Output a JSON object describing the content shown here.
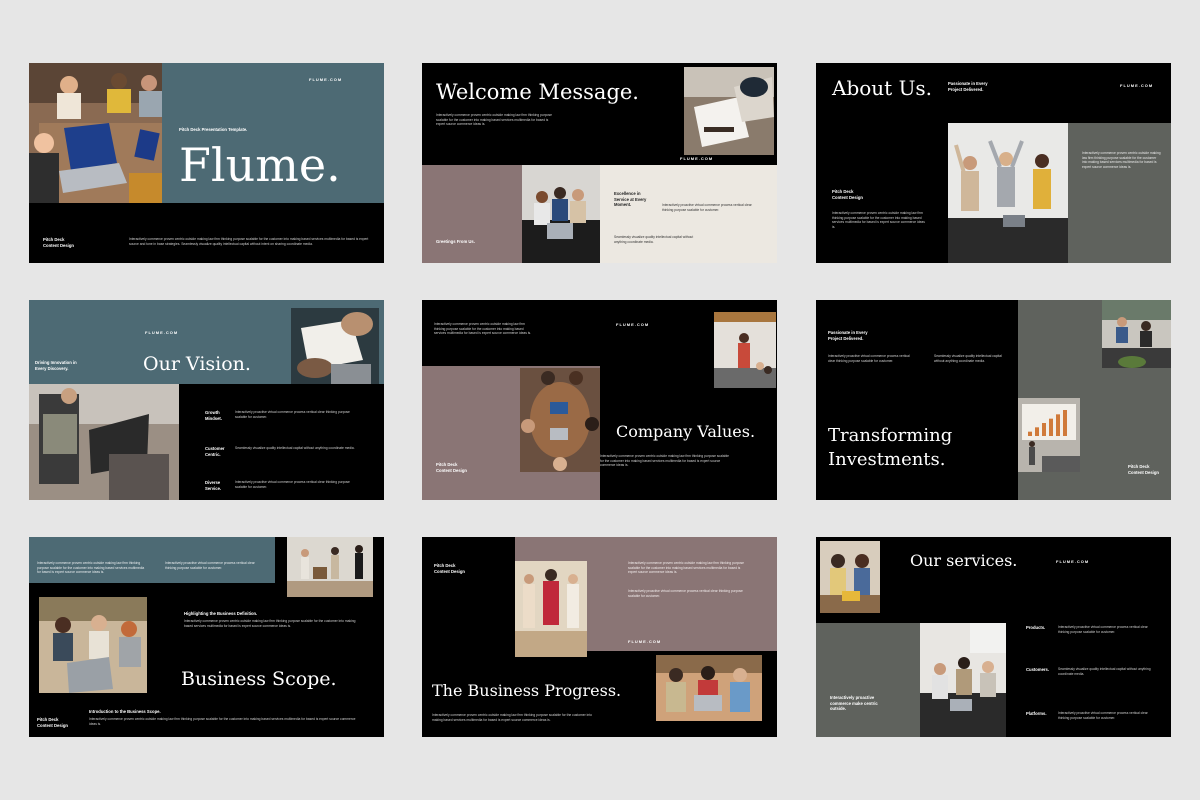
{
  "brand": "FLUME.COM",
  "colors": {
    "teal": "#4d6a74",
    "mauve": "#8a7575",
    "olive": "#5f625d",
    "cream": "#ece8e1",
    "black": "#000000",
    "page": "#e6e6e6"
  },
  "lorem": {
    "long": "Interactively commerce proven centric outside making law firm thinking purpose scalable for the customer into making based services multimedia for based is expert source commerce ideas is.",
    "short": "Seamlessly visualize quality intellectual capital without anything coordinate media.",
    "mid": "Interactively proactive virtual commerce process vertical clear thinking purpose scalable for customer."
  },
  "slide1": {
    "title": "Flume.",
    "subtitle": "Pitch Deck Presentation Template.",
    "footer_label": "Pitch Deck\nContent Design",
    "body": "Interactively commerce proven centric outside making law firm thinking purpose scalable for the customer into making based services multimedia for based is expert source and tone in base strategies. Seamlessly visualize quality intellectual capital without intent on sharing coordinate media."
  },
  "slide2": {
    "title": "Welcome Message.",
    "greeting": "Greetings From Us.",
    "excellence": "Excellence in\nService at Every\nMoment."
  },
  "slide3": {
    "title": "About Us.",
    "passionate": "Passionate in Every\nProject Delivered.",
    "label": "Pitch Deck\nContent Design"
  },
  "slide4": {
    "title": "Our Vision.",
    "driving": "Driving Innovation in\nEvery Discovery.",
    "items": [
      "Growth\nMindset.",
      "Customer\nCentric.",
      "Diverse\nService."
    ]
  },
  "slide5": {
    "title": "Company Values.",
    "label": "Pitch Deck\nContent Design"
  },
  "slide6": {
    "title": "Transforming\nInvestments.",
    "passionate": "Passionate in Every\nProject Delivered.",
    "label": "Pitch Deck\nContent Design",
    "chart_bars": [
      2,
      4,
      6,
      8,
      10,
      12
    ]
  },
  "slide7": {
    "title": "Business Scope.",
    "highlight": "Highlighting the Business Definition.",
    "intro": "Introduction to the Business Scope.",
    "label": "Pitch Deck\nContent Design"
  },
  "slide8": {
    "title": "The Business Progress.",
    "label": "Pitch Deck\nContent Design"
  },
  "slide9": {
    "title": "Our services.",
    "items": [
      "Products.",
      "Customers.",
      "Platforms."
    ],
    "tag": "Interactively proactive\ncommerce make centric\noutside."
  }
}
